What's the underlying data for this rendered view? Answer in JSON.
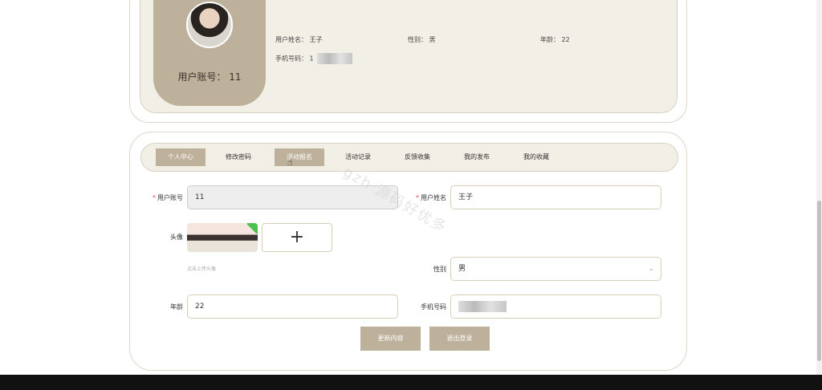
{
  "profile": {
    "account_label": "用户账号：",
    "account_value": "11",
    "name_label": "用户姓名：",
    "name_value": "王子",
    "gender_label": "性别：",
    "gender_value": "男",
    "age_label": "年龄：",
    "age_value": "22",
    "phone_label": "手机号码：",
    "phone_value": "1"
  },
  "tabs": [
    {
      "label": "个人中心"
    },
    {
      "label": "修改密码"
    },
    {
      "label": "活动报名"
    },
    {
      "label": "活动记录"
    },
    {
      "label": "反馈收集"
    },
    {
      "label": "我的发布"
    },
    {
      "label": "我的收藏"
    }
  ],
  "form": {
    "account_label": "用户账号",
    "account_value": "11",
    "name_label": "用户姓名",
    "name_value": "王子",
    "avatar_label": "头像",
    "upload_add": "+",
    "upload_hint": "点击上传头像",
    "gender_label": "性别",
    "gender_value": "男",
    "age_label": "年龄",
    "age_value": "22",
    "phone_label": "手机号码",
    "phone_value": ""
  },
  "buttons": {
    "update": "更新内容",
    "logout": "退出登录"
  },
  "watermark": "gzh 源码好优多",
  "colors": {
    "accent": "#beb19c",
    "panel": "#f2efe7",
    "border": "#d9cfb9",
    "required": "#e24a4a"
  }
}
